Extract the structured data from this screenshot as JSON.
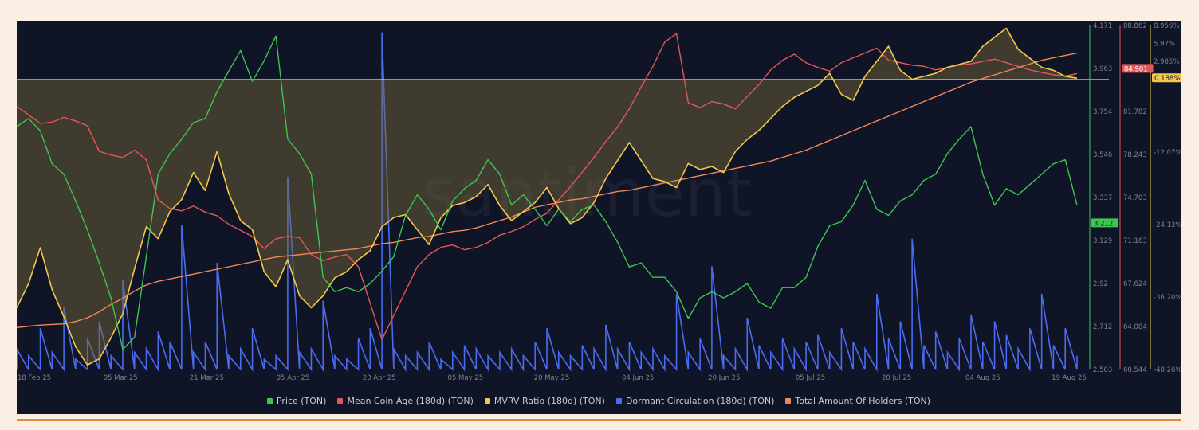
{
  "watermark": "santiment",
  "colors": {
    "price": "#3ec552",
    "coin_age": "#e5565a",
    "mvrv": "#f2c94c",
    "dormant": "#4a6cf0",
    "holders": "#f0875a",
    "axis_text": "#7d8396",
    "grid": "#232a3f"
  },
  "chart_data": {
    "type": "line",
    "grid": false,
    "legend_position": "bottom",
    "x_ticks": [
      "18 Feb 25",
      "05 Mar 25",
      "21 Mar 25",
      "05 Apr 25",
      "20 Apr 25",
      "05 May 25",
      "20 May 25",
      "04 Jun 25",
      "20 Jun 25",
      "05 Jul 25",
      "20 Jul 25",
      "04 Aug 25",
      "19 Aug 25"
    ],
    "axes": {
      "price": {
        "ticks": [
          "4.171",
          "3.963",
          "3.754",
          "3.546",
          "3.337",
          "3.129",
          "2.92",
          "2.712",
          "2.503"
        ],
        "range": [
          2.503,
          4.171
        ],
        "current": "3.212"
      },
      "coin_age": {
        "ticks": [
          "88.862",
          "85.322",
          "81.782",
          "78.243",
          "74.703",
          "71.163",
          "67.624",
          "64.084",
          "60.544"
        ],
        "range": [
          60.544,
          88.862
        ],
        "current": "84.901"
      },
      "mvrv": {
        "ticks": [
          "8.956%",
          "5.97%",
          "2.985%",
          "-12.07%",
          "-24.13%",
          "-36.20%",
          "-48.26%"
        ],
        "range": [
          -48.26,
          8.956
        ],
        "current": "0.188%"
      }
    },
    "series": [
      {
        "name": "Price (TON)",
        "color_key": "price",
        "axis": "price",
        "values": [
          3.68,
          3.72,
          3.66,
          3.5,
          3.45,
          3.32,
          3.18,
          3.02,
          2.85,
          2.6,
          2.66,
          3.05,
          3.45,
          3.55,
          3.62,
          3.7,
          3.72,
          3.85,
          3.95,
          4.05,
          3.9,
          4.0,
          4.12,
          3.62,
          3.55,
          3.45,
          2.95,
          2.88,
          2.9,
          2.88,
          2.92,
          2.98,
          3.05,
          3.25,
          3.35,
          3.28,
          3.18,
          3.32,
          3.38,
          3.42,
          3.52,
          3.45,
          3.3,
          3.35,
          3.28,
          3.2,
          3.28,
          3.22,
          3.28,
          3.3,
          3.22,
          3.12,
          3.0,
          3.02,
          2.95,
          2.95,
          2.88,
          2.75,
          2.85,
          2.88,
          2.85,
          2.88,
          2.92,
          2.83,
          2.8,
          2.9,
          2.9,
          2.95,
          3.1,
          3.2,
          3.22,
          3.3,
          3.42,
          3.28,
          3.25,
          3.32,
          3.35,
          3.42,
          3.45,
          3.55,
          3.62,
          3.68,
          3.45,
          3.3,
          3.38,
          3.35,
          3.4,
          3.45,
          3.5,
          3.52,
          3.3
        ]
      },
      {
        "name": "Mean Coin Age (180d) (TON)",
        "color_key": "coin_age",
        "axis": "coin_age",
        "values": [
          82.2,
          81.5,
          80.8,
          80.9,
          81.3,
          81.0,
          80.6,
          78.5,
          78.2,
          78.0,
          78.6,
          77.8,
          74.5,
          73.8,
          73.6,
          74.0,
          73.5,
          73.2,
          72.5,
          72.0,
          71.5,
          70.5,
          71.3,
          71.5,
          71.4,
          70.0,
          69.5,
          69.8,
          70.0,
          69.0,
          66.0,
          63.0,
          65.0,
          67.0,
          69.0,
          70.0,
          70.6,
          70.8,
          70.4,
          70.6,
          71.0,
          71.6,
          71.9,
          72.3,
          72.9,
          73.4,
          74.5,
          75.6,
          76.8,
          78.0,
          79.3,
          80.5,
          82.0,
          83.8,
          85.5,
          87.5,
          88.2,
          82.5,
          82.1,
          82.6,
          82.4,
          82.0,
          83.0,
          84.0,
          85.2,
          86.0,
          86.5,
          85.8,
          85.4,
          85.1,
          85.8,
          86.2,
          86.6,
          87.0,
          86.0,
          85.8,
          85.6,
          85.5,
          85.2,
          85.4,
          85.6,
          85.7,
          85.9,
          86.1,
          85.8,
          85.5,
          85.2,
          85.0,
          84.8,
          84.7,
          84.9
        ]
      },
      {
        "name": "MVRV Ratio (180d) (TON)",
        "color_key": "mvrv",
        "axis": "mvrv",
        "values": [
          -38.0,
          -34.0,
          -28.0,
          -35.0,
          -39.5,
          -44.5,
          -47.5,
          -46.5,
          -43.0,
          -39.0,
          -31.5,
          -24.5,
          -26.5,
          -22.0,
          -20.0,
          -15.5,
          -18.5,
          -12.0,
          -19.0,
          -23.5,
          -25.0,
          -32.0,
          -34.5,
          -30.0,
          -36.0,
          -38.0,
          -36.0,
          -33.0,
          -32.0,
          -30.0,
          -28.5,
          -24.5,
          -23.0,
          -22.5,
          -25.0,
          -27.5,
          -23.0,
          -21.0,
          -20.5,
          -19.5,
          -17.5,
          -21.0,
          -23.5,
          -22.0,
          -20.5,
          -18.0,
          -21.5,
          -24.0,
          -23.0,
          -20.5,
          -16.5,
          -13.5,
          -10.5,
          -13.5,
          -16.5,
          -17.0,
          -18.0,
          -14.0,
          -15.0,
          -14.5,
          -15.5,
          -12.0,
          -10.0,
          -8.5,
          -6.5,
          -4.5,
          -3.0,
          -2.0,
          -1.0,
          1.0,
          -2.5,
          -3.5,
          0.5,
          3.0,
          5.5,
          1.5,
          0.0,
          0.5,
          1.0,
          2.0,
          2.5,
          3.0,
          5.5,
          7.0,
          8.5,
          5.0,
          3.5,
          2.0,
          1.5,
          0.5,
          0.19
        ]
      },
      {
        "name": "Dormant Circulation (180d) (TON)",
        "color_key": "dormant",
        "values": [
          6,
          4,
          12,
          5,
          18,
          3,
          9,
          14,
          4,
          26,
          5,
          6,
          11,
          8,
          42,
          5,
          8,
          31,
          4,
          6,
          12,
          3,
          4,
          56,
          5,
          6,
          20,
          4,
          3,
          9,
          12,
          98,
          6,
          4,
          5,
          8,
          3,
          5,
          7,
          6,
          4,
          5,
          6,
          4,
          8,
          12,
          5,
          4,
          7,
          6,
          13,
          6,
          8,
          5,
          6,
          4,
          22,
          5,
          9,
          30,
          4,
          6,
          15,
          7,
          5,
          9,
          6,
          8,
          10,
          5,
          12,
          8,
          6,
          22,
          9,
          14,
          38,
          7,
          11,
          5,
          9,
          16,
          8,
          14,
          10,
          6,
          12,
          22,
          7,
          12,
          4
        ]
      },
      {
        "name": "Total Amount Of Holders (TON)",
        "color_key": "holders",
        "axis": "coin_age",
        "values": [
          64.0,
          64.1,
          64.2,
          64.25,
          64.3,
          64.5,
          64.8,
          65.3,
          65.9,
          66.4,
          67.0,
          67.5,
          67.8,
          68.0,
          68.2,
          68.4,
          68.6,
          68.8,
          69.0,
          69.2,
          69.4,
          69.6,
          69.8,
          69.9,
          70.0,
          70.1,
          70.2,
          70.3,
          70.4,
          70.5,
          70.7,
          70.9,
          71.0,
          71.2,
          71.4,
          71.5,
          71.7,
          71.9,
          72.0,
          72.2,
          72.5,
          72.8,
          73.1,
          73.5,
          73.9,
          74.1,
          74.3,
          74.5,
          74.6,
          74.8,
          75.0,
          75.2,
          75.3,
          75.5,
          75.7,
          75.9,
          76.1,
          76.3,
          76.5,
          76.7,
          76.9,
          77.1,
          77.3,
          77.5,
          77.7,
          78.0,
          78.3,
          78.6,
          79.0,
          79.4,
          79.8,
          80.2,
          80.6,
          81.0,
          81.4,
          81.8,
          82.2,
          82.6,
          83.0,
          83.4,
          83.8,
          84.2,
          84.5,
          84.8,
          85.1,
          85.4,
          85.7,
          86.0,
          86.2,
          86.4,
          86.6
        ]
      }
    ]
  },
  "legend": [
    {
      "label": "Price (TON)",
      "color_key": "price"
    },
    {
      "label": "Mean Coin Age (180d) (TON)",
      "color_key": "coin_age"
    },
    {
      "label": "MVRV Ratio (180d) (TON)",
      "color_key": "mvrv"
    },
    {
      "label": "Dormant Circulation (180d) (TON)",
      "color_key": "dormant"
    },
    {
      "label": "Total Amount Of Holders (TON)",
      "color_key": "holders"
    }
  ]
}
